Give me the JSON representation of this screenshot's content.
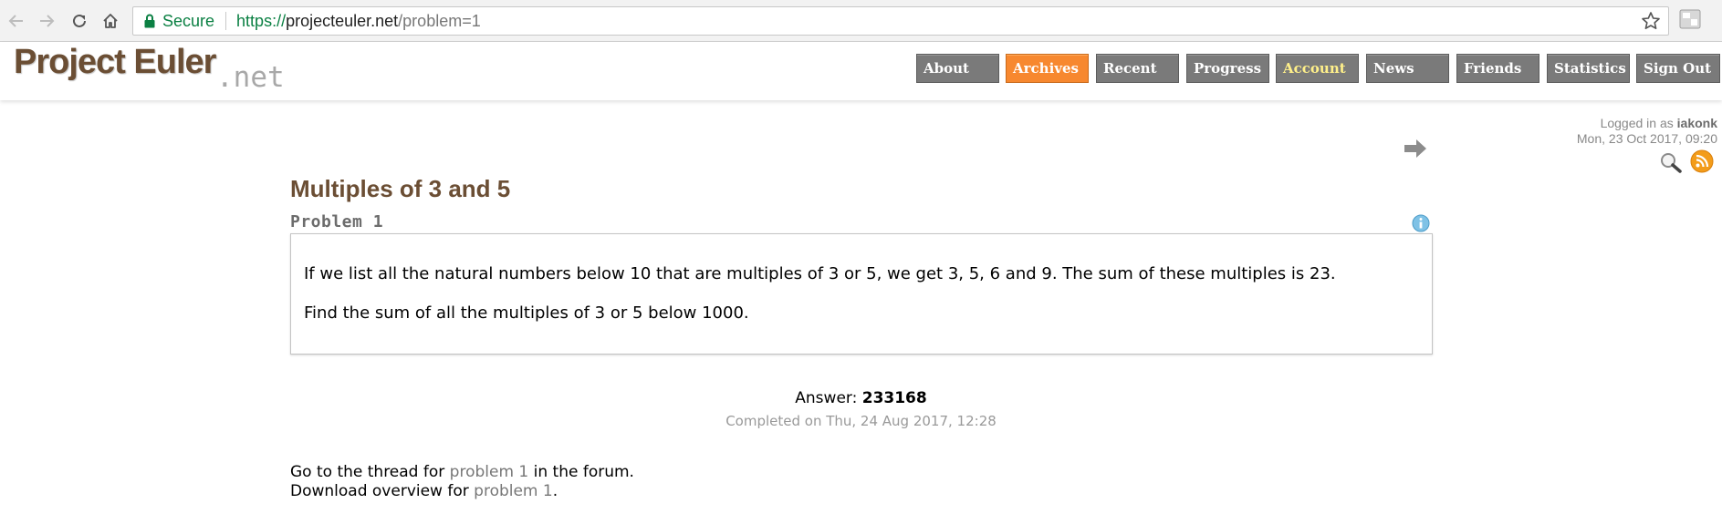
{
  "browser": {
    "secure_label": "Secure",
    "url_scheme": "https://",
    "url_host": "projecteuler.net",
    "url_path": "/problem=1"
  },
  "logo": {
    "main": "Project Euler",
    "sub": ".net"
  },
  "menu": [
    {
      "label": "About"
    },
    {
      "label": "Archives"
    },
    {
      "label": "Recent"
    },
    {
      "label": "Progress"
    },
    {
      "label": "Account"
    },
    {
      "label": "News"
    },
    {
      "label": "Friends"
    },
    {
      "label": "Statistics"
    },
    {
      "label": "Sign Out"
    }
  ],
  "login": {
    "prefix": "Logged in as",
    "username": "iakonk",
    "datetime": "Mon, 23 Oct 2017, 09:20"
  },
  "problem": {
    "title": "Multiples of 3 and 5",
    "number": "Problem 1",
    "paragraphs": [
      "If we list all the natural numbers below 10 that are multiples of 3 or 5, we get 3, 5, 6 and 9. The sum of these multiples is 23.",
      "Find the sum of all the multiples of 3 or 5 below 1000."
    ]
  },
  "answer": {
    "label": "Answer:",
    "value": "233168",
    "completed": "Completed on Thu, 24 Aug 2017, 12:28"
  },
  "links": {
    "thread_prefix": "Go to the thread for",
    "thread_link": "problem 1",
    "thread_suffix": "in the forum.",
    "download_prefix": "Download overview for",
    "download_link": "problem 1",
    "download_suffix": "."
  },
  "colors": {
    "brand_brown": "#6b4e34",
    "menu_gray": "#7a7a7a",
    "menu_active": "#f7882f",
    "account_yellow": "#fff08a",
    "secure_green": "#0b8043"
  }
}
